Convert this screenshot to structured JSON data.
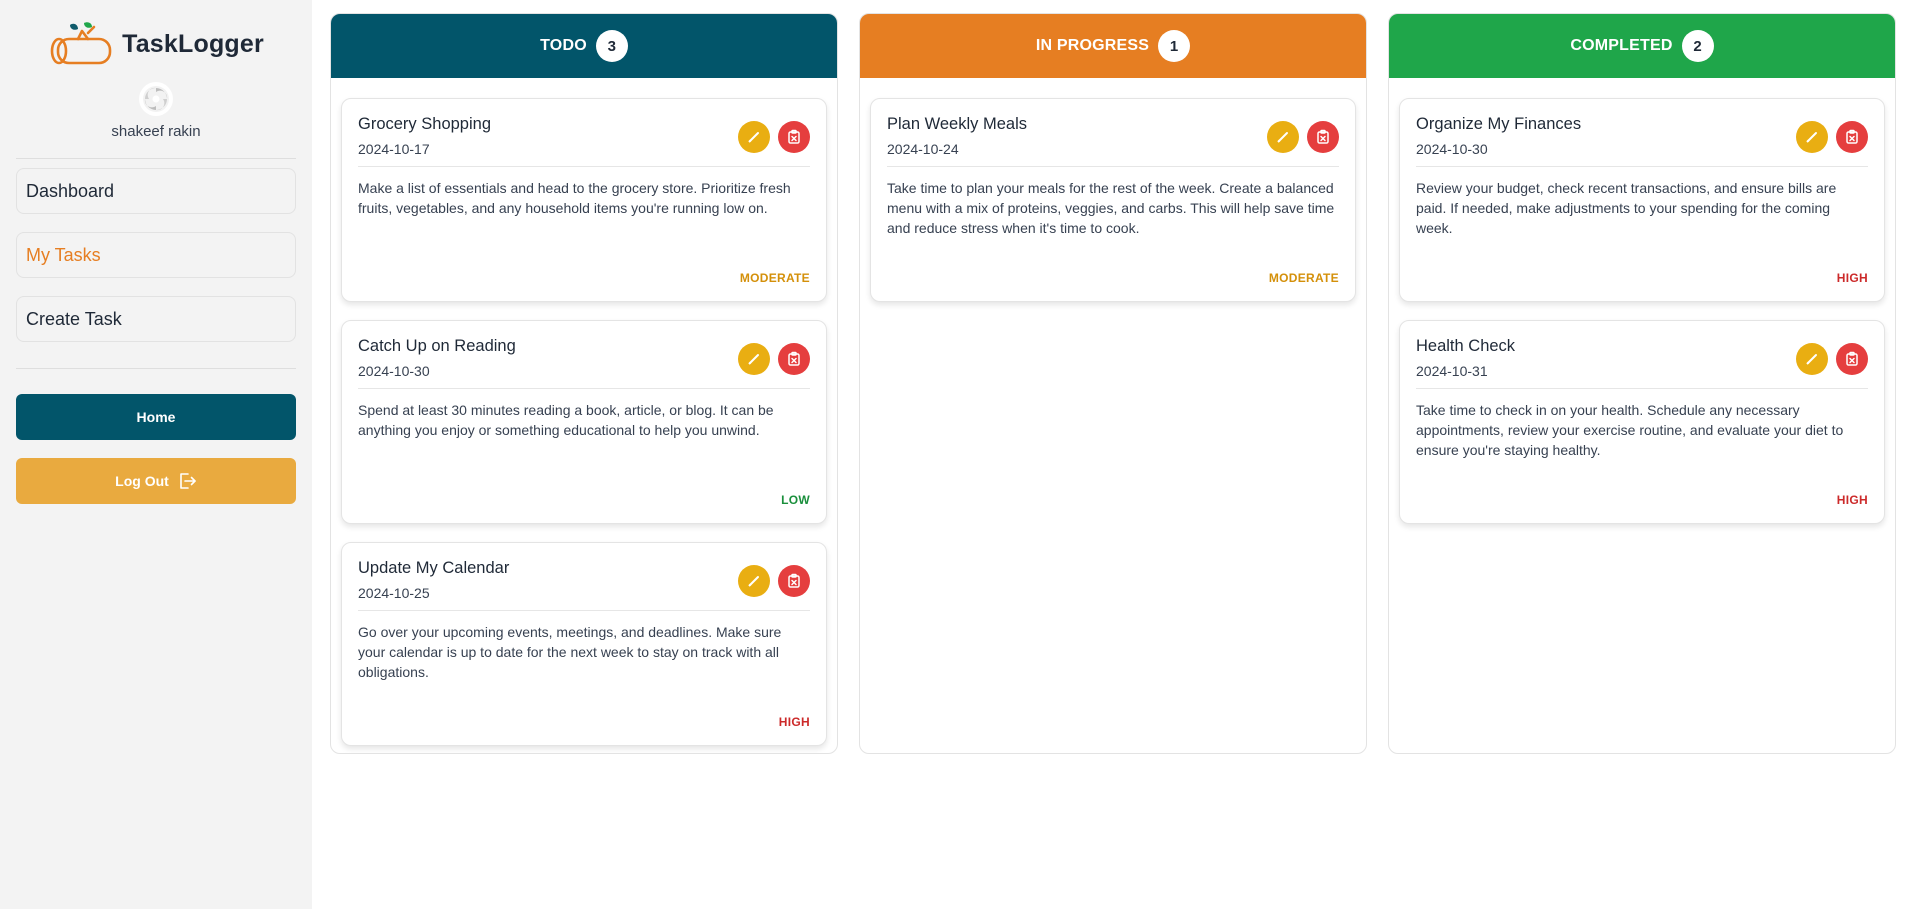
{
  "brand": {
    "name": "TaskLogger"
  },
  "profile": {
    "username": "shakeef rakin"
  },
  "nav": [
    {
      "label": "Dashboard",
      "active": false
    },
    {
      "label": "My Tasks",
      "active": true
    },
    {
      "label": "Create Task",
      "active": false
    }
  ],
  "buttons": {
    "home": "Home",
    "logout": "Log Out"
  },
  "colors": {
    "todo": "#02556a",
    "in_progress": "#e67e22",
    "completed": "#1fa64a",
    "moderate": "#d4900a",
    "low": "#1a8f3c",
    "high": "#cc2a2a"
  },
  "columns": [
    {
      "title": "TODO",
      "count": "3",
      "tasks": [
        {
          "title": "Grocery Shopping",
          "date": "2024-10-17",
          "description": "Make a list of essentials and head to the grocery store. Prioritize fresh fruits, vegetables, and any household items you're running low on.",
          "priority": "MODERATE"
        },
        {
          "title": "Catch Up on Reading",
          "date": "2024-10-30",
          "description": "Spend at least 30 minutes reading a book, article, or blog. It can be anything you enjoy or something educational to help you unwind.",
          "priority": "LOW"
        },
        {
          "title": "Update My Calendar",
          "date": "2024-10-25",
          "description": "Go over your upcoming events, meetings, and deadlines. Make sure your calendar is up to date for the next week to stay on track with all obligations.",
          "priority": "HIGH"
        }
      ]
    },
    {
      "title": "IN PROGRESS",
      "count": "1",
      "tasks": [
        {
          "title": "Plan Weekly Meals",
          "date": "2024-10-24",
          "description": "Take time to plan your meals for the rest of the week. Create a balanced menu with a mix of proteins, veggies, and carbs. This will help save time and reduce stress when it's time to cook.",
          "priority": "MODERATE"
        }
      ]
    },
    {
      "title": "COMPLETED",
      "count": "2",
      "tasks": [
        {
          "title": "Organize My Finances",
          "date": "2024-10-30",
          "description": "Review your budget, check recent transactions, and ensure bills are paid. If needed, make adjustments to your spending for the coming week.",
          "priority": "HIGH"
        },
        {
          "title": "Health Check",
          "date": "2024-10-31",
          "description": "Take time to check in on your health. Schedule any necessary appointments, review your exercise routine, and evaluate your diet to ensure you're staying healthy.",
          "priority": "HIGH"
        }
      ]
    }
  ]
}
